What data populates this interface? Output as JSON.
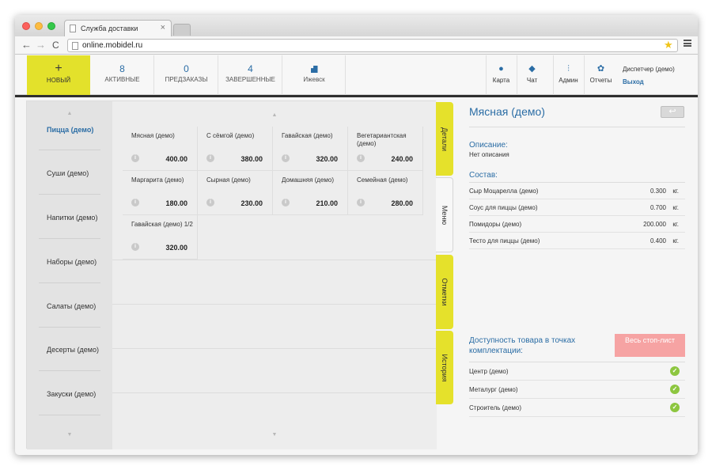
{
  "browser": {
    "tab_title": "Служба доставки",
    "tab_close": "×",
    "url": "online.mobidel.ru",
    "back": "←",
    "forward": "→",
    "reload": "C",
    "star": "★"
  },
  "header": {
    "new_plus": "+",
    "new_label": "НОВЫЙ",
    "stats": [
      {
        "num": "8",
        "label": "АКТИВНЫЕ"
      },
      {
        "num": "0",
        "label": "ПРЕДЗАКАЗЫ"
      },
      {
        "num": "4",
        "label": "ЗАВЕРШЕННЫЕ"
      }
    ],
    "city": "Ижевск",
    "nav": [
      {
        "icon": "map-pin-icon",
        "glyph": "●",
        "label": "Карта"
      },
      {
        "icon": "chat-icon",
        "glyph": "◆",
        "label": "Чат"
      },
      {
        "icon": "sliders-icon",
        "glyph": "⫶",
        "label": "Админ"
      },
      {
        "icon": "gear-icon",
        "glyph": "✿",
        "label": "Отчеты"
      }
    ],
    "dispatcher": "Диспетчер (демо)",
    "logout": "Выход"
  },
  "categories": {
    "up": "▲",
    "down": "▼",
    "items": [
      "Пицца (демо)",
      "Суши (демо)",
      "Напитки (демо)",
      "Наборы (демо)",
      "Салаты (демо)",
      "Десерты (демо)",
      "Закуски (демо)"
    ],
    "active_index": 0
  },
  "products": {
    "up": "▲",
    "down": "▼",
    "info_glyph": "i",
    "items": [
      {
        "name": "Мясная (демо)",
        "price": "400.00"
      },
      {
        "name": "С сёмгой (демо)",
        "price": "380.00"
      },
      {
        "name": "Гавайская (демо)",
        "price": "320.00"
      },
      {
        "name": "Вегетариантская (демо)",
        "price": "240.00"
      },
      {
        "name": "Маргарита (демо)",
        "price": "180.00"
      },
      {
        "name": "Сырная (демо)",
        "price": "230.00"
      },
      {
        "name": "Домашняя (демо)",
        "price": "210.00"
      },
      {
        "name": "Семейная (демо)",
        "price": "280.00"
      },
      {
        "name": "Гавайская (демо) 1/2",
        "price": "320.00"
      }
    ]
  },
  "side_tabs": [
    {
      "label": "Детали",
      "active": false
    },
    {
      "label": "Меню",
      "active": true
    },
    {
      "label": "Отметки",
      "active": false
    },
    {
      "label": "История",
      "active": false
    }
  ],
  "details": {
    "title": "Мясная (демо)",
    "back_glyph": "↩",
    "description_label": "Описание:",
    "description": "Нет описания",
    "composition_label": "Состав:",
    "ingredients": [
      {
        "name": "Сыр Моцарелла (демо)",
        "qty": "0.300",
        "unit": "кг."
      },
      {
        "name": "Соус для пиццы (демо)",
        "qty": "0.700",
        "unit": "кг."
      },
      {
        "name": "Помидоры (демо)",
        "qty": "200.000",
        "unit": "кг."
      },
      {
        "name": "Тесто для пиццы (демо)",
        "qty": "0.400",
        "unit": "кг."
      }
    ],
    "availability_label": "Доступность товара в точках комплектации:",
    "stoplist_label": "Весь стоп-лист",
    "check_glyph": "✓",
    "points": [
      "Центр (демо)",
      "Металург (демо)",
      "Строитель (демо)"
    ]
  },
  "colors": {
    "accent_yellow": "#e3e12b",
    "link_blue": "#2b6da5",
    "stoplist_red": "#f6a3a3",
    "check_green": "#8dc63f"
  }
}
